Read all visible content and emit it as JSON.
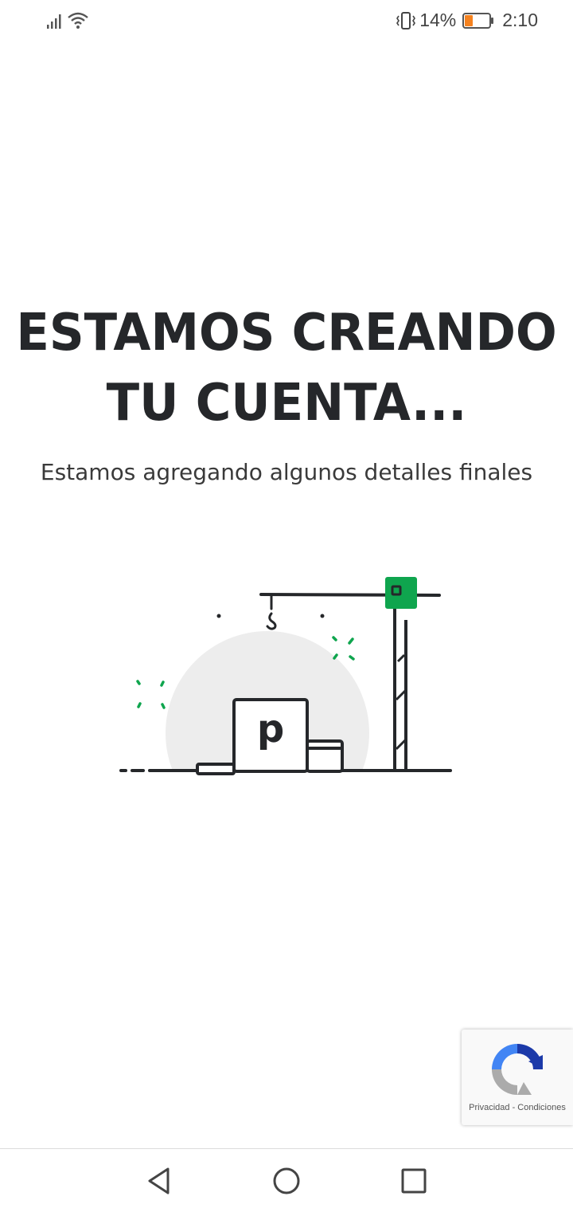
{
  "status_bar": {
    "battery_percent": "14%",
    "time": "2:10",
    "battery_level": 0.14,
    "battery_color": "#f5821f"
  },
  "main": {
    "headline_line1": "ESTAMOS CREANDO",
    "headline_line2": "TU CUENTA...",
    "subtitle": "Estamos agregando algunos detalles finales",
    "logo_letter": "p"
  },
  "illustration": {
    "accent_color": "#0fa54e",
    "circle_color": "#ededed",
    "line_color": "#25272a"
  },
  "recaptcha": {
    "privacy": "Privacidad",
    "separator": "-",
    "terms": "Condiciones"
  },
  "nav": {
    "back_icon": "triangle-back-icon",
    "home_icon": "circle-home-icon",
    "recents_icon": "square-recents-icon"
  }
}
